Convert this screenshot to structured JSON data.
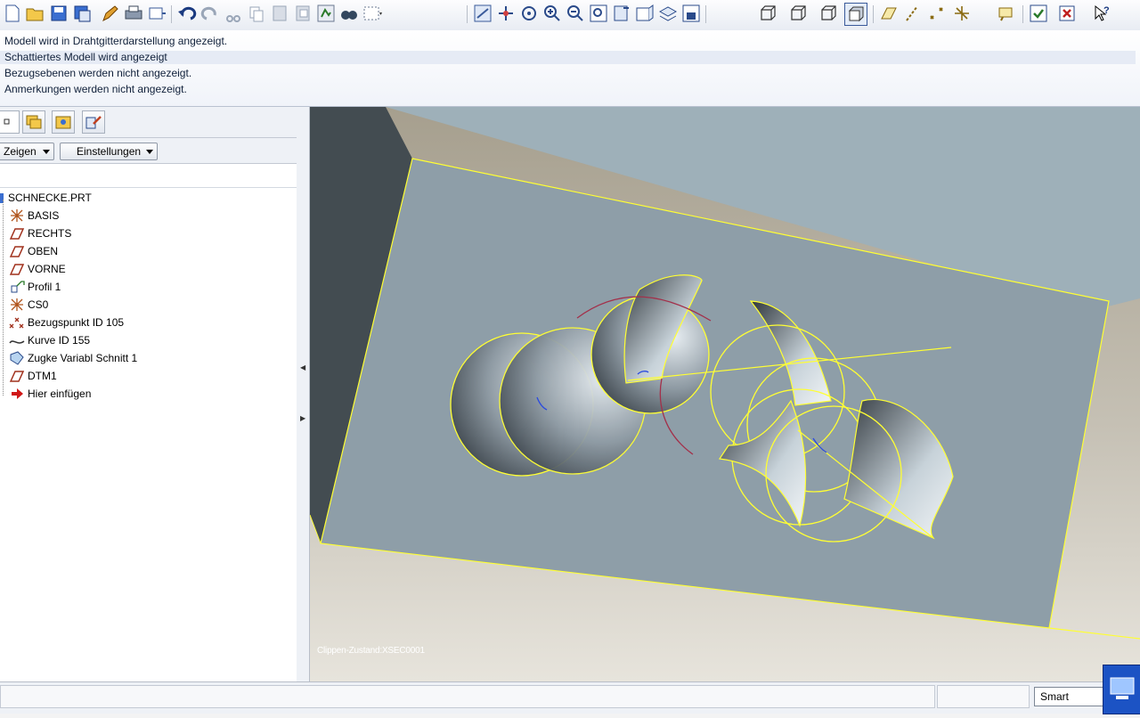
{
  "toolbar": {
    "icons": [
      "new-icon",
      "open-icon",
      "save-icon",
      "save-copy-icon",
      "edit-icon",
      "print-icon",
      "send-icon",
      "undo-icon",
      "redo-icon",
      "cut-icon",
      "copy-icon",
      "paste-icon",
      "paste-special-icon",
      "regenerate-icon",
      "find-icon",
      "select-box-icon",
      "repaint-icon",
      "spin-center-icon",
      "orient-icon",
      "zoom-in-icon",
      "zoom-out-icon",
      "refit-icon",
      "view-manager-icon",
      "reorient-icon",
      "layers-icon",
      "saved-views-icon",
      "wireframe-icon",
      "hidden-line-icon",
      "no-hidden-icon",
      "shading-icon",
      "datum-planes-icon",
      "datum-axes-icon",
      "datum-points-icon",
      "csys-icon",
      "annotations-icon",
      "verify-icon",
      "close-icon",
      "help-icon"
    ]
  },
  "messages": [
    "Modell wird in Drahtgitterdarstellung angezeigt.",
    "Schattiertes Modell wird angezeigt",
    "Bezugsebenen werden nicht angezeigt.",
    "Anmerkungen werden nicht angezeigt."
  ],
  "nav": {
    "buttons": {
      "show": "Zeigen",
      "settings": "Einstellungen"
    },
    "tree": [
      {
        "label": "SCHNECKE.PRT",
        "icon": "part-icon"
      },
      {
        "label": "BASIS",
        "icon": "csys-icon"
      },
      {
        "label": "RECHTS",
        "icon": "datum-plane-icon"
      },
      {
        "label": "OBEN",
        "icon": "datum-plane-icon"
      },
      {
        "label": "VORNE",
        "icon": "datum-plane-icon"
      },
      {
        "label": "Profil 1",
        "icon": "profile-icon"
      },
      {
        "label": "CS0",
        "icon": "csys-icon"
      },
      {
        "label": "Bezugspunkt ID 105",
        "icon": "datum-point-icon"
      },
      {
        "label": "Kurve ID 155",
        "icon": "curve-icon"
      },
      {
        "label": "Zugke Variabl Schnitt 1",
        "icon": "sweep-icon"
      },
      {
        "label": "DTM1",
        "icon": "datum-plane-icon"
      },
      {
        "label": "Hier einfügen",
        "icon": "insert-here-icon"
      }
    ]
  },
  "viewport": {
    "clip_state": "Clippen-Zustand:XSEC0001"
  },
  "status": {
    "filter_value": "Smart"
  },
  "colors": {
    "edge_highlight": "#ffff33",
    "sketch_curve": "#a3304a",
    "block_face": "#8e9ea8"
  }
}
